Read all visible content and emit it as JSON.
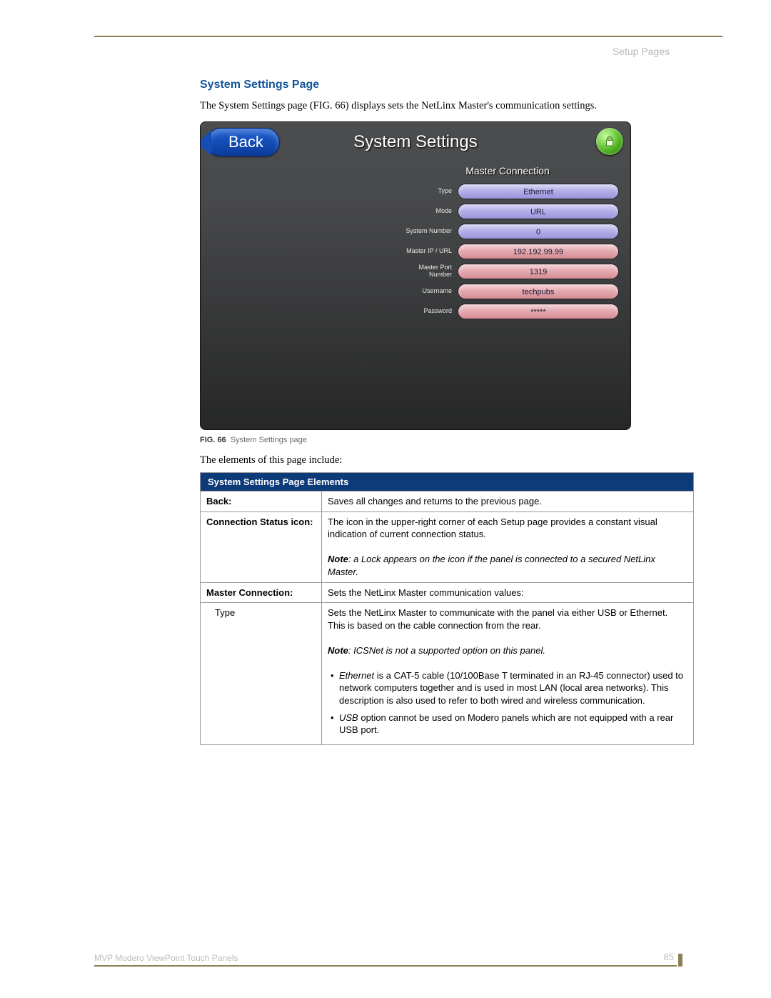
{
  "header": {
    "section": "Setup Pages"
  },
  "section": {
    "title": "System Settings Page",
    "intro": "The System Settings page (FIG. 66) displays sets the NetLinx Master's communication settings."
  },
  "panel": {
    "back_label": "Back",
    "title": "System Settings",
    "master_connection": {
      "header": "Master Connection",
      "rows": {
        "type": {
          "label": "Type",
          "value": "Ethernet"
        },
        "mode": {
          "label": "Mode",
          "value": "URL"
        },
        "sysnum": {
          "label": "System Number",
          "value": "0"
        },
        "ipurl": {
          "label": "Master IP / URL",
          "value": "192.192.99.99"
        },
        "port": {
          "label": "Master Port Number",
          "value": "1319"
        },
        "user": {
          "label": "Username",
          "value": "techpubs"
        },
        "pass": {
          "label": "Password",
          "value": "*****"
        }
      }
    }
  },
  "figure": {
    "ref": "FIG. 66",
    "caption": "System Settings page"
  },
  "lead": "The elements of this page include:",
  "table": {
    "header": "System Settings Page Elements",
    "rows": {
      "back": {
        "label": "Back:",
        "desc": "Saves all changes and returns to the previous page."
      },
      "conn": {
        "label": "Connection Status icon:",
        "desc": "The icon in the upper-right corner of each Setup page provides a constant visual indication of current connection status.",
        "note_prefix": "Note",
        "note": ": a Lock appears on the icon if the panel is connected to a secured NetLinx Master."
      },
      "master": {
        "label": "Master Connection:",
        "desc": "Sets the NetLinx Master communication values:"
      },
      "type": {
        "label": "Type",
        "desc": "Sets the NetLinx Master to communicate with the panel via either USB or Ethernet. This is based on the cable connection from the rear.",
        "note_prefix": "Note",
        "note": ": ICSNet is not a supported option on this panel.",
        "bullet1_em": "Ethernet",
        "bullet1_rest": " is a CAT-5 cable (10/100Base T terminated in an RJ-45 connector) used to network computers together and is used in most LAN (local area networks). This description is also used to refer to both wired and wireless communication.",
        "bullet2_em": "USB",
        "bullet2_rest": " option cannot be used on Modero panels which are not equipped with a rear USB port."
      }
    }
  },
  "footer": {
    "text": "MVP Modero ViewPoint Touch Panels",
    "page": "85"
  }
}
